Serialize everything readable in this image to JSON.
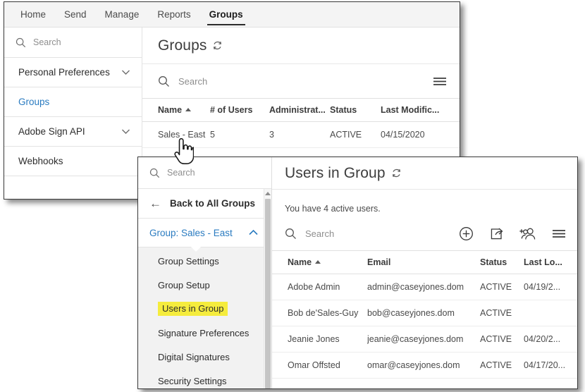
{
  "topnav": {
    "items": [
      {
        "label": "Home",
        "active": false
      },
      {
        "label": "Send",
        "active": false
      },
      {
        "label": "Manage",
        "active": false
      },
      {
        "label": "Reports",
        "active": false
      },
      {
        "label": "Groups",
        "active": true
      }
    ]
  },
  "groups_window": {
    "sidebar": {
      "search_placeholder": "Search",
      "items": [
        {
          "label": "Personal Preferences",
          "chevron": "chevron-down",
          "selected": false
        },
        {
          "label": "Groups",
          "chevron": "",
          "selected": true
        },
        {
          "label": "Adobe Sign API",
          "chevron": "chevron-down",
          "selected": false
        },
        {
          "label": "Webhooks",
          "chevron": "",
          "selected": false
        }
      ]
    },
    "page_title": "Groups",
    "refresh_icon": "refresh-icon",
    "search_placeholder": "Search",
    "menu_icon": "hamburger-menu-icon",
    "table": {
      "columns": [
        "Name",
        "# of Users",
        "Administrat...",
        "Status",
        "Last Modific..."
      ],
      "sort_column": "Name",
      "sort_direction": "asc",
      "rows": [
        {
          "name": "Sales - East",
          "users": "5",
          "administrators": "3",
          "status": "ACTIVE",
          "last_modified": "04/15/2020"
        }
      ]
    }
  },
  "users_window": {
    "sidebar": {
      "search_placeholder": "Search",
      "back_label": "Back to All Groups",
      "back_icon": "arrow-left-icon",
      "group_header": "Group: Sales - East",
      "group_chevron": "chevron-up",
      "items": [
        {
          "label": "Group Settings",
          "highlighted": false
        },
        {
          "label": "Group Setup",
          "highlighted": false
        },
        {
          "label": "Users in Group",
          "highlighted": true
        },
        {
          "label": "Signature Preferences",
          "highlighted": false
        },
        {
          "label": "Digital Signatures",
          "highlighted": false
        },
        {
          "label": "Security Settings",
          "highlighted": false
        }
      ]
    },
    "page_title": "Users in Group",
    "refresh_icon": "refresh-icon",
    "note": "You have 4 active users.",
    "search_placeholder": "Search",
    "toolbar": [
      {
        "icon": "add-user-plus-circle-icon",
        "label": "Create a new user"
      },
      {
        "icon": "export-share-icon",
        "label": "Export user list"
      },
      {
        "icon": "add-users-to-group-icon",
        "label": "Add users to group"
      },
      {
        "icon": "hamburger-menu-icon",
        "label": "Options"
      }
    ],
    "table": {
      "columns": [
        "Name",
        "Email",
        "Status",
        "Last Lo..."
      ],
      "sort_column": "Name",
      "sort_direction": "asc",
      "rows": [
        {
          "name": "Adobe Admin",
          "email": "admin@caseyjones.dom",
          "status": "ACTIVE",
          "last_login": "04/19/2..."
        },
        {
          "name": "Bob de'Sales-Guy",
          "email": "bob@caseyjones.dom",
          "status": "ACTIVE",
          "last_login": ""
        },
        {
          "name": "Jeanie Jones",
          "email": "jeanie@caseyjones.dom",
          "status": "ACTIVE",
          "last_login": "04/20/2..."
        },
        {
          "name": "Omar Offsted",
          "email": "omar@caseyjones.dom",
          "status": "ACTIVE",
          "last_login": "04/17/20..."
        }
      ]
    }
  },
  "cursor": {
    "icon": "pointing-hand-cursor"
  },
  "colors": {
    "accent_blue": "#2a7bc0",
    "highlight_yellow": "#f5ec3d",
    "text_dark": "#2c2c2c",
    "text_muted": "#8e8e8e",
    "topnav_bg": "#f4f4f4",
    "submenu_bg": "#f2f2f2"
  }
}
